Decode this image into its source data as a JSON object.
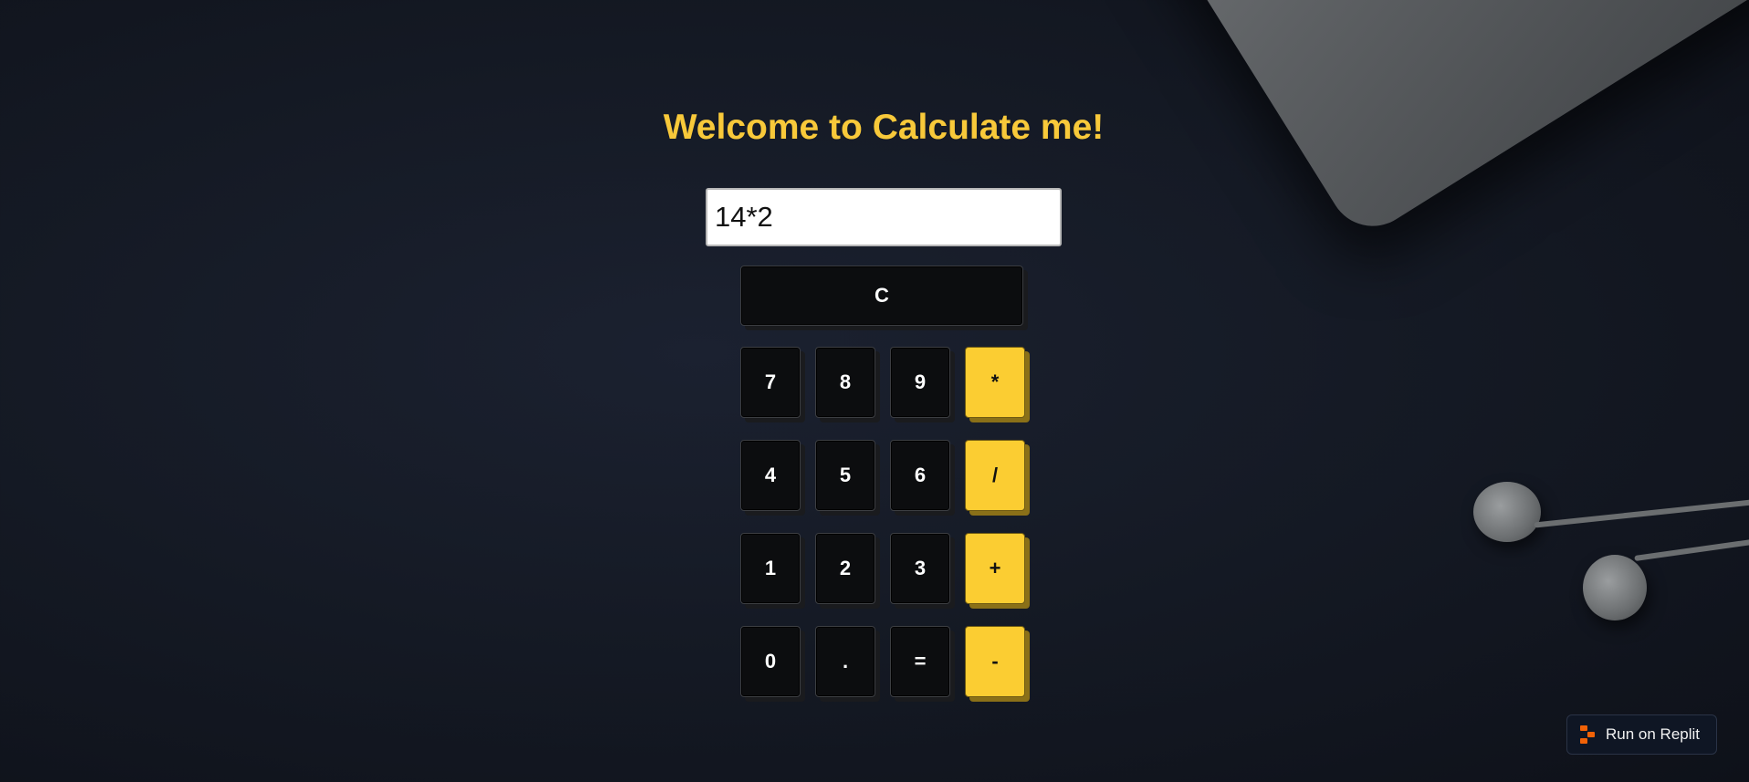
{
  "header": {
    "title": "Welcome to Calculate me!"
  },
  "display": {
    "value": "14*2"
  },
  "controls": {
    "clear_label": "C"
  },
  "keypad": {
    "rows": [
      [
        {
          "label": "7",
          "kind": "digit"
        },
        {
          "label": "8",
          "kind": "digit"
        },
        {
          "label": "9",
          "kind": "digit"
        },
        {
          "label": "*",
          "kind": "operator"
        }
      ],
      [
        {
          "label": "4",
          "kind": "digit"
        },
        {
          "label": "5",
          "kind": "digit"
        },
        {
          "label": "6",
          "kind": "digit"
        },
        {
          "label": "/",
          "kind": "operator"
        }
      ],
      [
        {
          "label": "1",
          "kind": "digit"
        },
        {
          "label": "2",
          "kind": "digit"
        },
        {
          "label": "3",
          "kind": "digit"
        },
        {
          "label": "+",
          "kind": "operator"
        }
      ],
      [
        {
          "label": "0",
          "kind": "digit"
        },
        {
          "label": ".",
          "kind": "digit"
        },
        {
          "label": "=",
          "kind": "digit"
        },
        {
          "label": "-",
          "kind": "operator"
        }
      ]
    ]
  },
  "replit_badge": {
    "label": "Run on Replit",
    "icon": "replit-icon"
  },
  "colors": {
    "accent": "#fbcd32",
    "title": "#f8c93a",
    "key_dark": "#0c0d0f",
    "replit_brand": "#f26207"
  }
}
